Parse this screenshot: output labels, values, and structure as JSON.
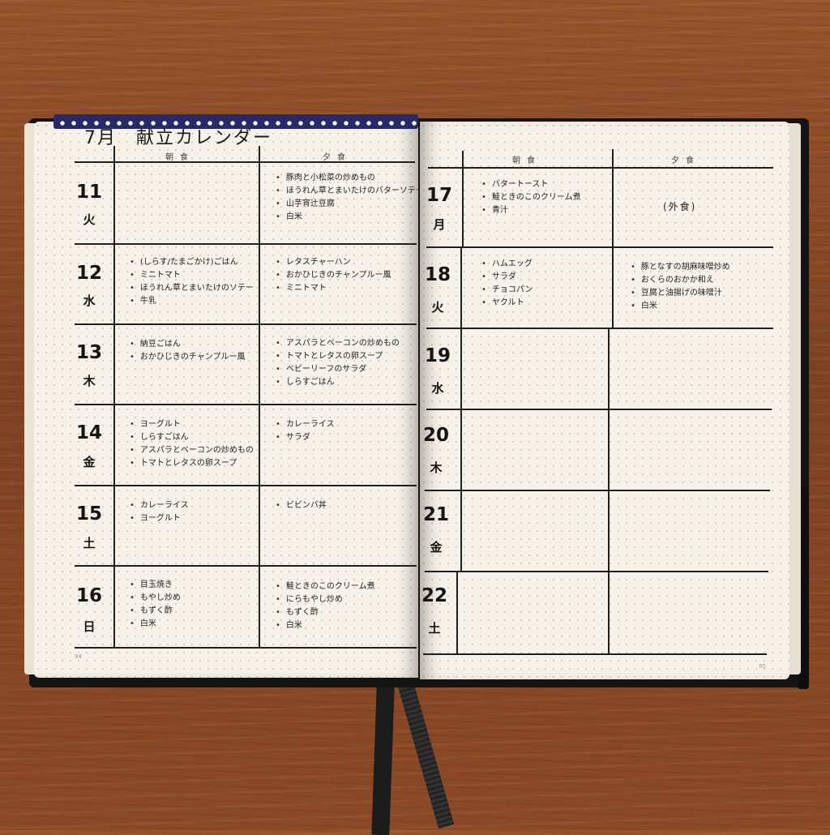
{
  "title": "7月　献立カレンダー",
  "headers": {
    "breakfast": "朝食",
    "dinner": "夕食"
  },
  "left_page": {
    "page_number": "94",
    "days": [
      {
        "num": "11",
        "dow": "火",
        "breakfast": [],
        "dinner": [
          "豚肉と小松菜の炒めもの",
          "ほうれん草とまいたけのバターソテー",
          "山芋宵辻豆腐",
          "白米"
        ]
      },
      {
        "num": "12",
        "dow": "水",
        "breakfast": [
          "(しらす/たまごかけ)ごはん",
          "ミニトマト",
          "ほうれん草とまいたけのソテー",
          "牛乳"
        ],
        "dinner": [
          "レタスチャーハン",
          "おかひじきのチャンプルー風",
          "ミニトマト"
        ]
      },
      {
        "num": "13",
        "dow": "木",
        "breakfast": [
          "納豆ごはん",
          "おかひじきのチャンプルー風"
        ],
        "dinner": [
          "アスパラとベーコンの炒めもの",
          "トマトとレタスの卵スープ",
          "ベビーリーフのサラダ",
          "しらすごはん"
        ]
      },
      {
        "num": "14",
        "dow": "金",
        "breakfast": [
          "ヨーグルト",
          "しらすごはん",
          "アスパラとベーコンの炒めもの",
          "トマトとレタスの卵スープ"
        ],
        "dinner": [
          "カレーライス",
          "サラダ"
        ]
      },
      {
        "num": "15",
        "dow": "土",
        "breakfast": [
          "カレーライス",
          "ヨーグルト"
        ],
        "dinner": [
          "ビビンバ丼"
        ]
      },
      {
        "num": "16",
        "dow": "日",
        "breakfast": [
          "目玉焼き",
          "もやし炒め",
          "もずく酢",
          "白米"
        ],
        "dinner": [
          "鮭ときのこのクリーム煮",
          "にらもやし炒め",
          "もずく酢",
          "白米"
        ]
      }
    ]
  },
  "right_page": {
    "page_number": "95",
    "days": [
      {
        "num": "17",
        "dow": "月",
        "breakfast": [
          "バタートースト",
          "鮭ときのこのクリーム煮",
          "青汁"
        ],
        "dinner": [],
        "dinner_note": "(外食)"
      },
      {
        "num": "18",
        "dow": "火",
        "breakfast": [
          "ハムエッグ",
          "サラダ",
          "チョコパン",
          "ヤクルト"
        ],
        "dinner": [
          "豚となすの胡麻味噌炒め",
          "おくらのおかか和え",
          "豆腐と油揚げの味噌汁",
          "白米"
        ]
      },
      {
        "num": "19",
        "dow": "水",
        "breakfast": [],
        "dinner": []
      },
      {
        "num": "20",
        "dow": "木",
        "breakfast": [],
        "dinner": []
      },
      {
        "num": "21",
        "dow": "金",
        "breakfast": [],
        "dinner": []
      },
      {
        "num": "22",
        "dow": "土",
        "breakfast": [],
        "dinner": []
      }
    ]
  }
}
